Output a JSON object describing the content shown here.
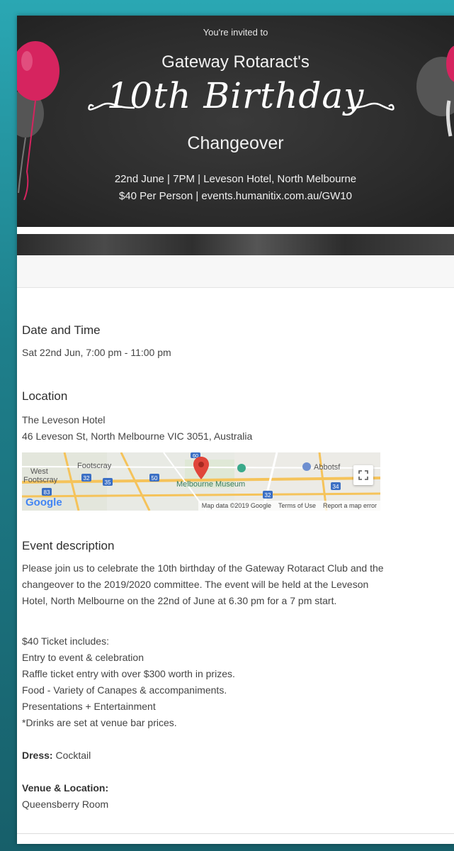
{
  "banner": {
    "invited": "You're invited to",
    "club": "Gateway Rotaract's",
    "script_title": "10th Birthday",
    "changeover": "Changeover",
    "details_line1": "22nd June | 7PM | Leveson Hotel, North Melbourne",
    "details_line2": "$40 Per Person | events.humanitix.com.au/GW10"
  },
  "date_time": {
    "heading": "Date and Time",
    "value": "Sat 22nd Jun, 7:00 pm - 11:00 pm"
  },
  "location": {
    "heading": "Location",
    "name": "The Leveson Hotel",
    "address": "46 Leveson St, North Melbourne VIC 3051, Australia",
    "map": {
      "labels": [
        "West",
        "Footscray",
        "Footscray",
        "Melbourne Museum",
        "Abbotsf"
      ],
      "route_badges": [
        "32",
        "35",
        "50",
        "83",
        "60",
        "32",
        "34"
      ],
      "google": "Google",
      "footer": [
        "Map data ©2019 Google",
        "Terms of Use",
        "Report a map error"
      ]
    }
  },
  "description": {
    "heading": "Event description",
    "paragraph": "Please join us to celebrate the 10th birthday of the Gateway Rotaract Club and the changeover to the 2019/2020 committee. The event will be held at the Leveson Hotel, North Melbourne on the 22nd of June at 6.30 pm for a 7 pm start.",
    "ticket_heading": "$40 Ticket includes:",
    "ticket_items": [
      "Entry to event & celebration",
      "Raffle ticket entry with over $300 worth in prizes.",
      "Food - Variety of Canapes & accompaniments.",
      "Presentations + Entertainment",
      "*Drinks are set at venue bar prices."
    ],
    "dress_label": "Dress:",
    "dress_value": " Cocktail",
    "venue_label": "Venue & Location:",
    "venue_value": "Queensberry Room"
  },
  "colors": {
    "frame": "#1f7f8b",
    "banner": "#2c2c2c",
    "balloon_pink": "#d6245f",
    "map_pin": "#e0463a"
  }
}
